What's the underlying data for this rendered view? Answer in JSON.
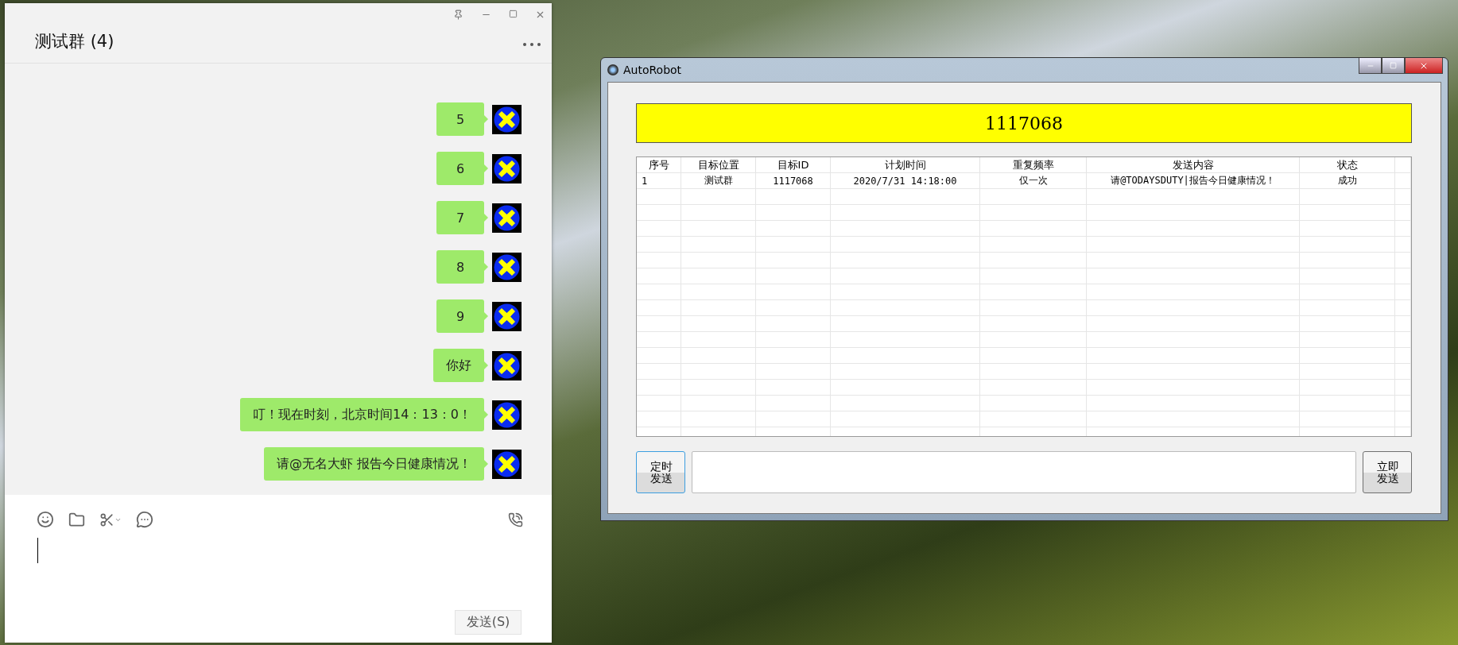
{
  "chat_window": {
    "title": "测试群 (4)",
    "messages": [
      {
        "text": "5"
      },
      {
        "text": "6"
      },
      {
        "text": "7"
      },
      {
        "text": "8"
      },
      {
        "text": "9"
      },
      {
        "text": "你好"
      },
      {
        "text": "叮！现在时刻，北京时间14：13：0！"
      },
      {
        "text": "请@无名大虾 报告今日健康情况！"
      }
    ],
    "send_button": "发送(S)"
  },
  "autorobot_window": {
    "title": "AutoRobot",
    "display": "1117068",
    "table": {
      "columns": [
        "序号",
        "目标位置",
        "目标ID",
        "计划时间",
        "重复频率",
        "发送内容",
        "状态"
      ],
      "rows": [
        [
          "1",
          "测试群",
          "1117068",
          "2020/7/31 14:18:00",
          "仅一次",
          "请@TODAYSDUTY|报告今日健康情况！",
          "成功"
        ]
      ]
    },
    "buttons": [
      {
        "kind": "schedule",
        "label": "定时发送",
        "focused": true
      },
      {
        "kind": "now",
        "label": "立即发送",
        "focused": false
      }
    ]
  }
}
